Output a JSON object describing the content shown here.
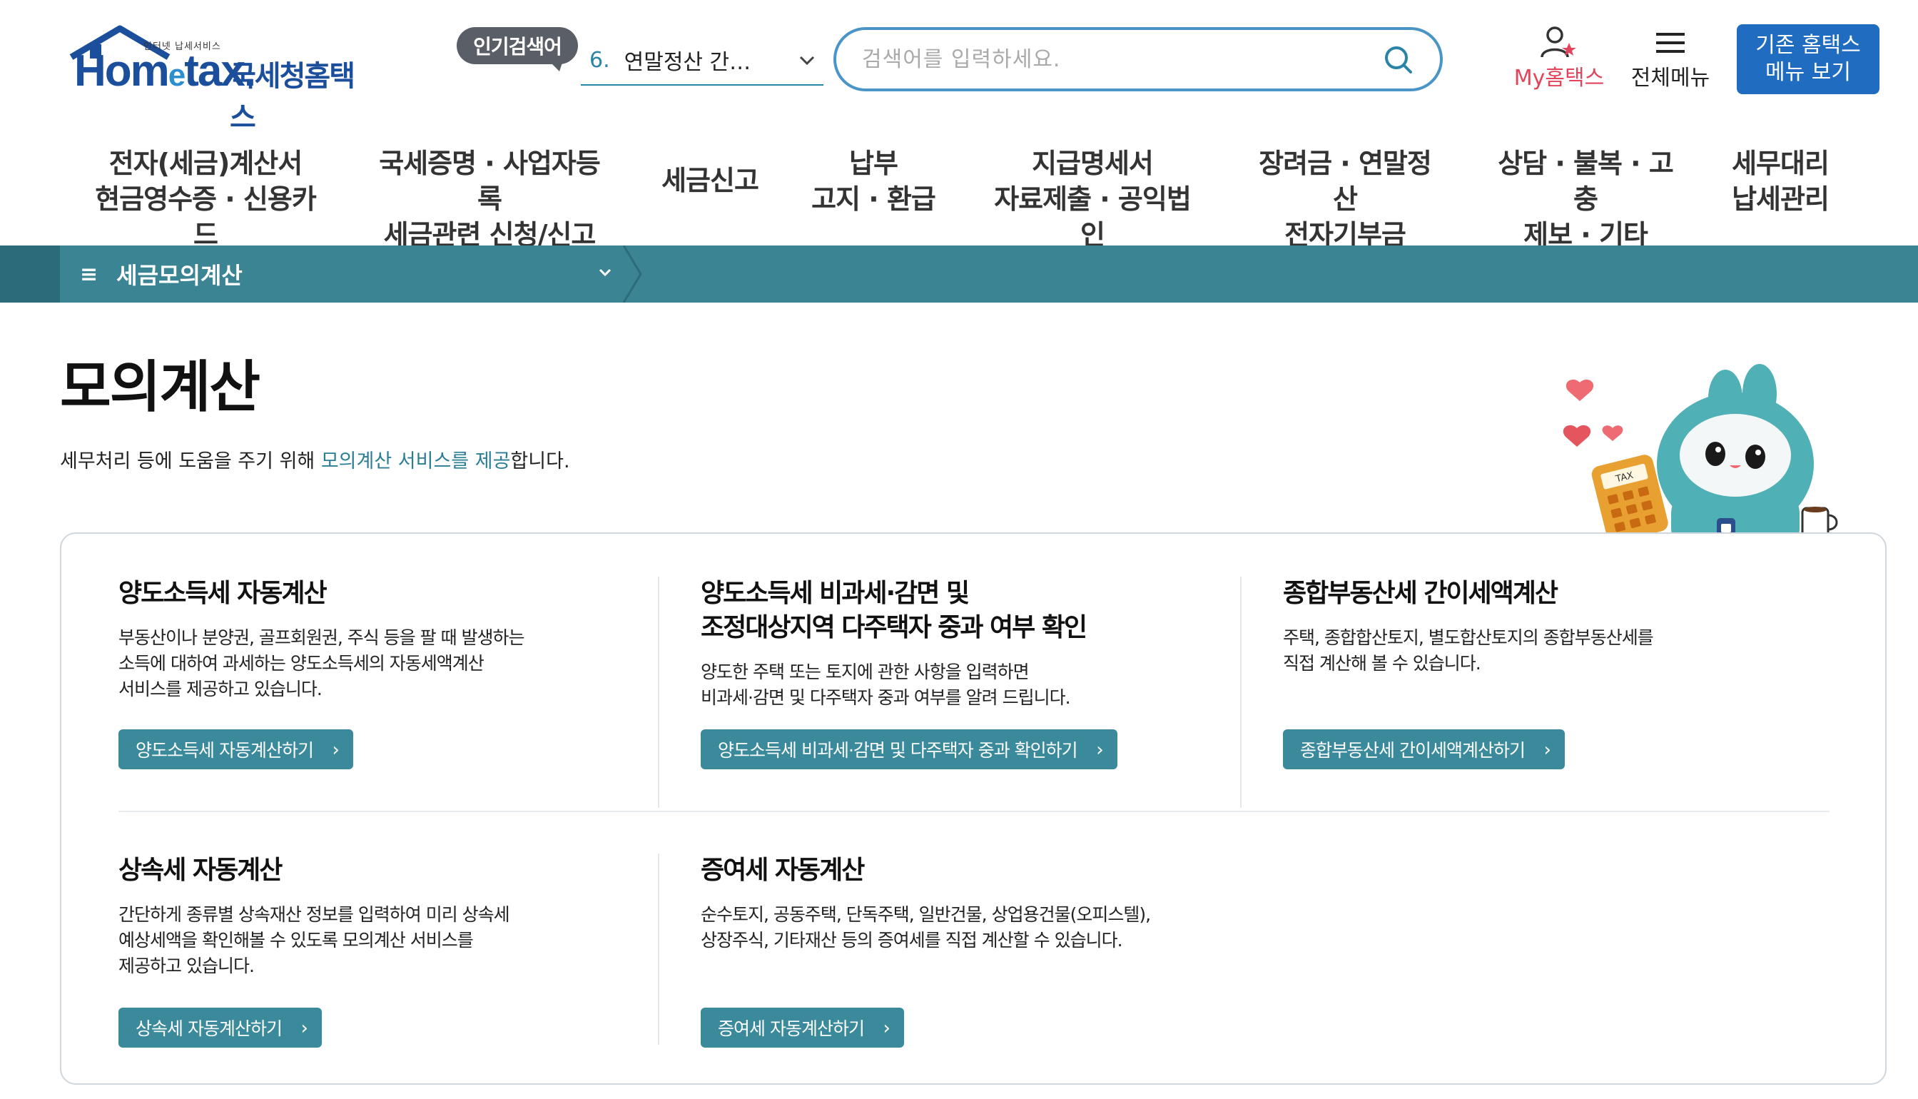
{
  "header": {
    "logo_tag": "인터넷 납세서비스",
    "logo_main_pre": "Hom",
    "logo_main_e": "e",
    "logo_main_post": "tax.",
    "logo_sub": "국세청홈택스",
    "popular_badge": "인기검색어",
    "popular_num": "6.",
    "popular_text": "연말정산 간…",
    "search_placeholder": "검색어를 입력하세요.",
    "mytax_label": "My홈택스",
    "allmenu_label": "전체메뉴",
    "oldmenu_label": "기존 홈택스\n메뉴 보기"
  },
  "gnb": [
    {
      "label": "전자(세금)계산서\n현금영수증 · 신용카드"
    },
    {
      "label": "국세증명 · 사업자등록\n세금관련 신청/신고"
    },
    {
      "label": "세금신고"
    },
    {
      "label": "납부\n고지 · 환급"
    },
    {
      "label": "지급명세서\n자료제출 · 공익법인"
    },
    {
      "label": "장려금 · 연말정산\n전자기부금"
    },
    {
      "label": "상담 · 불복 · 고충\n제보 · 기타"
    },
    {
      "label": "세무대리\n납세관리"
    }
  ],
  "subbar": {
    "selected": "세금모의계산"
  },
  "page": {
    "title": "모의계산",
    "desc_pre": "세무처리 등에 도움을 주기 위해 ",
    "desc_hl": "모의계산 서비스를 제공",
    "desc_post": "합니다."
  },
  "mascot": {
    "calc_label": "TAX"
  },
  "cards": [
    {
      "title": "양도소득세 자동계산",
      "desc": "부동산이나 분양권, 골프회원권, 주식 등을 팔 때 발생하는\n소득에 대하여 과세하는 양도소득세의 자동세액계산\n서비스를 제공하고 있습니다.",
      "button": "양도소득세 자동계산하기"
    },
    {
      "title": "양도소득세 비과세·감면 및\n조정대상지역 다주택자 중과 여부 확인",
      "desc": "양도한 주택 또는 토지에 관한 사항을 입력하면\n비과세·감면 및 다주택자 중과 여부를 알려 드립니다.",
      "button": "양도소득세 비과세·감면 및 다주택자 중과 확인하기"
    },
    {
      "title": "종합부동산세 간이세액계산",
      "desc": "주택, 종합합산토지, 별도합산토지의 종합부동산세를\n직접 계산해 볼 수 있습니다.",
      "button": "종합부동산세 간이세액계산하기"
    },
    {
      "title": "상속세 자동계산",
      "desc": "간단하게 종류별 상속재산 정보를 입력하여 미리 상속세\n예상세액을 확인해볼 수 있도록 모의계산 서비스를\n제공하고 있습니다.",
      "button": "상속세 자동계산하기"
    },
    {
      "title": "증여세 자동계산",
      "desc": "순수토지, 공동주택, 단독주택, 일반건물, 상업용건물(오피스텔),\n상장주식, 기타재산 등의 증여세를 직접 계산할 수 있습니다.",
      "button": "증여세 자동계산하기"
    }
  ],
  "colors": {
    "brand_blue": "#1b4f9c",
    "teal": "#3a8494",
    "button_teal": "#3a8a9c",
    "mytax_red": "#e2445c",
    "old_menu_blue": "#1f6cc0"
  }
}
